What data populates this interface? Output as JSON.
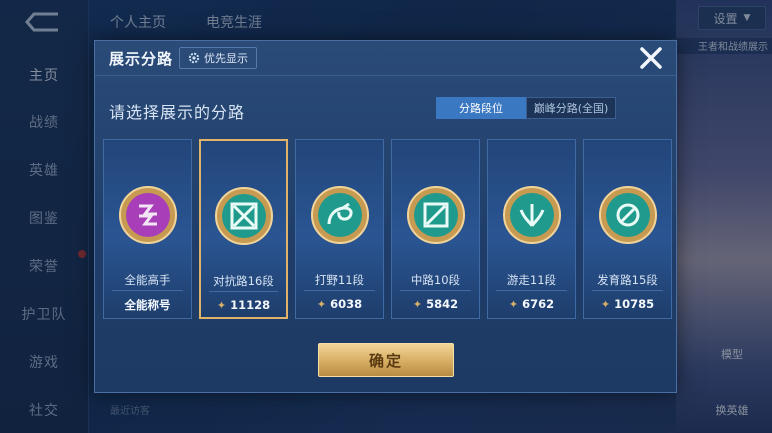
{
  "background": {
    "top_tabs": [
      "个人主页",
      "电竞生涯"
    ],
    "settings_label": "设置",
    "sidebar": [
      {
        "label": "主页",
        "active": true
      },
      {
        "label": "战绩",
        "active": false
      },
      {
        "label": "英雄",
        "active": false
      },
      {
        "label": "图鉴",
        "active": false
      },
      {
        "label": "荣誉",
        "active": false
      },
      {
        "label": "护卫队",
        "active": false
      },
      {
        "label": "游戏",
        "active": false
      },
      {
        "label": "社交",
        "active": false
      }
    ],
    "right_banner": "王者和战绩展示",
    "right_labels": [
      "模型",
      "换英雄"
    ],
    "recent_visits": "最近访客"
  },
  "modal": {
    "title": "展示分路",
    "priority_button": "优先显示",
    "subtitle": "请选择展示的分路",
    "mode_tabs": [
      {
        "label": "分路段位",
        "active": true
      },
      {
        "label": "巅峰分路(全国)",
        "active": false
      }
    ],
    "cards": [
      {
        "rank": "全能高手",
        "score": "全能称号",
        "emblem": "all-round-emblem-icon",
        "color": "#a83fb8",
        "selected": false
      },
      {
        "rank": "对抗路16段",
        "score": "11128",
        "emblem": "clash-lane-emblem-icon",
        "color": "#1f9a8c",
        "selected": true
      },
      {
        "rank": "打野11段",
        "score": "6038",
        "emblem": "jungle-emblem-icon",
        "color": "#1f9a8c",
        "selected": false
      },
      {
        "rank": "中路10段",
        "score": "5842",
        "emblem": "mid-lane-emblem-icon",
        "color": "#1f9a8c",
        "selected": false
      },
      {
        "rank": "游走11段",
        "score": "6762",
        "emblem": "roam-emblem-icon",
        "color": "#1f9a8c",
        "selected": false
      },
      {
        "rank": "发育路15段",
        "score": "10785",
        "emblem": "farm-lane-emblem-icon",
        "color": "#1f9a8c",
        "selected": false
      }
    ],
    "confirm_label": "确定"
  },
  "colors": {
    "accent_tab": "#3a78c2",
    "gold": "#d7ad62",
    "selected_border": "#e0b36a"
  }
}
